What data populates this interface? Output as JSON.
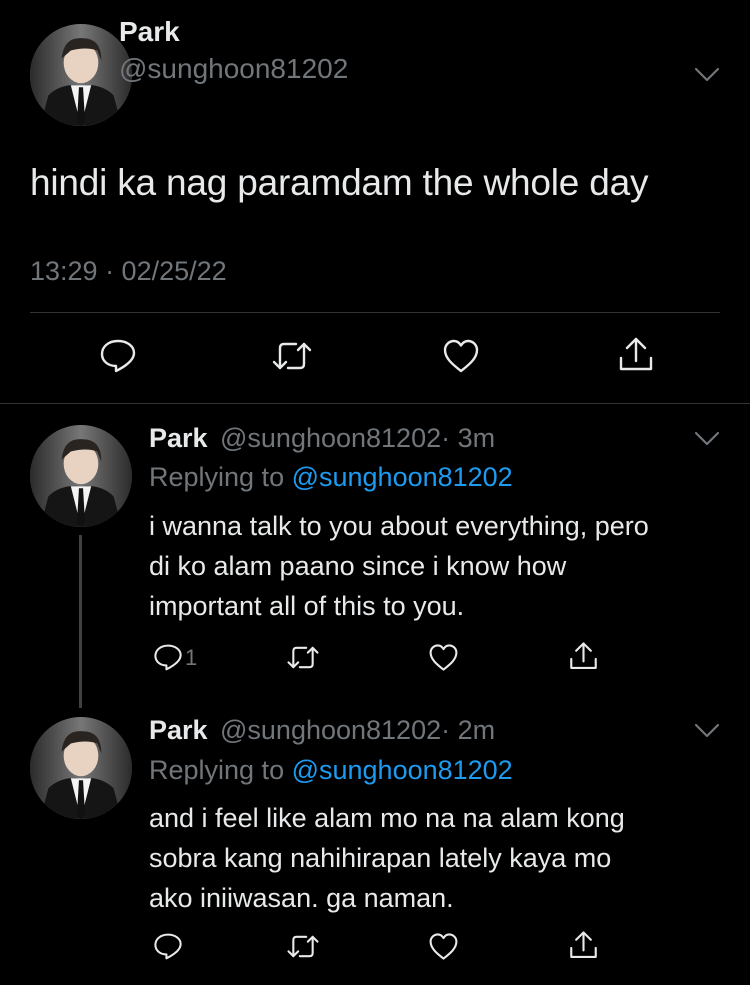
{
  "main_tweet": {
    "name": "Park",
    "handle": "@sunghoon81202",
    "text": "hindi ka nag paramdam the whole day",
    "timestamp": "13:29 · 02/25/22"
  },
  "replies": [
    {
      "name": "Park",
      "handle": "@sunghoon81202",
      "time": "· 3m",
      "replying_prefix": "Replying to ",
      "replying_to": "@sunghoon81202",
      "lines": [
        "i wanna talk to you about everything, pero",
        "di ko alam paano since i know how",
        "important all of this to you."
      ],
      "reply_count": "1"
    },
    {
      "name": "Park",
      "handle": "@sunghoon81202",
      "time": "· 2m",
      "replying_prefix": "Replying to ",
      "replying_to": "@sunghoon81202",
      "lines": [
        "and i feel like alam mo na na alam kong",
        "sobra kang nahihirapan lately kaya mo",
        "ako iniiwasan. ga naman."
      ],
      "reply_count": ""
    }
  ],
  "icons": {
    "reply": "reply-icon",
    "retweet": "retweet-icon",
    "like": "heart-icon",
    "share": "share-icon",
    "more": "chevron-down-icon"
  },
  "colors": {
    "background": "#000000",
    "text": "#e7e9ea",
    "muted": "#71767b",
    "link": "#1d9bf0",
    "divider": "#2f3336"
  }
}
